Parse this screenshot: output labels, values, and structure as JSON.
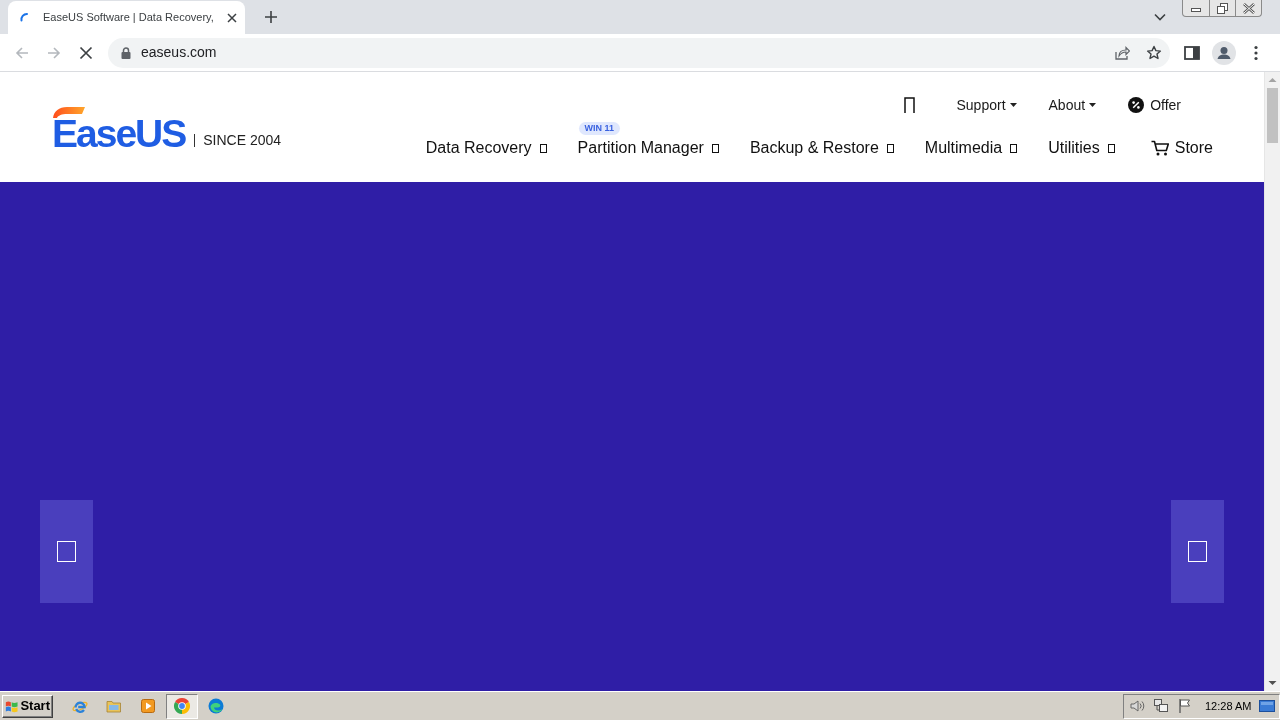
{
  "browser": {
    "tabs": [
      {
        "title": "EaseUS Software | Data Recovery,",
        "selected": true
      }
    ],
    "loading": true,
    "back": {
      "disabled": true
    },
    "forward": {
      "disabled": true
    },
    "address": "easeus.com"
  },
  "site": {
    "logo": {
      "name": "EaseUS",
      "tagline": "SINCE 2004"
    },
    "top_links": [
      {
        "label": "Support",
        "kind": "dropdown"
      },
      {
        "label": "About",
        "kind": "dropdown"
      },
      {
        "label": "Offer",
        "kind": "offer"
      }
    ],
    "nav": [
      {
        "label": "Data Recovery",
        "kind": "menu"
      },
      {
        "label": "Partition Manager",
        "kind": "menu",
        "badge": "WIN 11"
      },
      {
        "label": "Backup & Restore",
        "kind": "menu"
      },
      {
        "label": "Multimedia",
        "kind": "menu"
      },
      {
        "label": "Utilities",
        "kind": "menu"
      },
      {
        "label": "Store",
        "kind": "store"
      }
    ]
  },
  "taskbar": {
    "start": "Start",
    "apps": [
      {
        "kind": "ie",
        "selected": false
      },
      {
        "kind": "folder",
        "selected": false
      },
      {
        "kind": "player",
        "selected": false
      },
      {
        "kind": "chrome",
        "selected": true
      },
      {
        "kind": "edge",
        "selected": false
      }
    ],
    "clock": "12:28 AM"
  }
}
